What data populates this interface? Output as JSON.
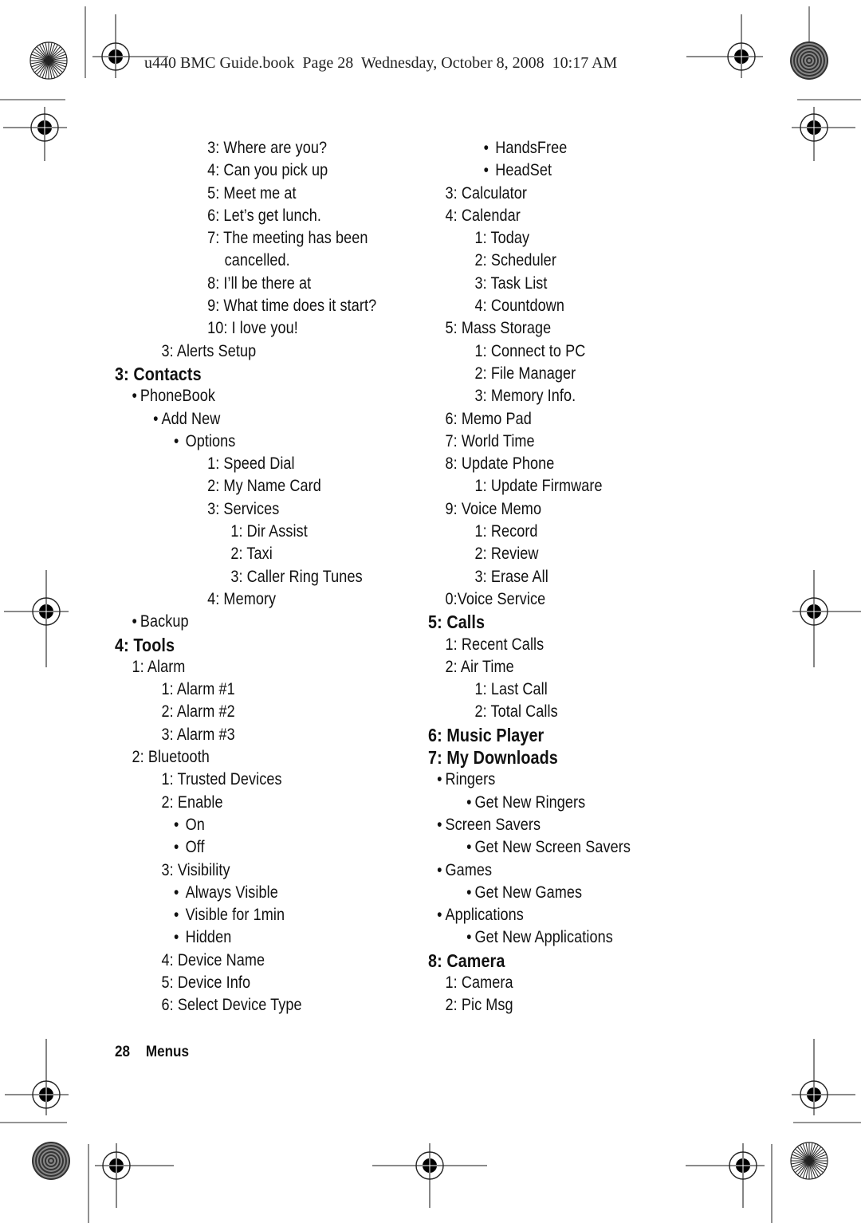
{
  "header": {
    "slug": "u440 BMC Guide.book  Page 28  Wednesday, October 8, 2008  10:17 AM"
  },
  "left_column": [
    {
      "text": "3: Where are you?",
      "level": 4,
      "kind": "item"
    },
    {
      "text": "4: Can you pick up",
      "level": 4,
      "kind": "item"
    },
    {
      "text": "5: Meet me at",
      "level": 4,
      "kind": "item"
    },
    {
      "text": "6: Let’s get lunch.",
      "level": 4,
      "kind": "item"
    },
    {
      "text": "7: The meeting has been",
      "level": 4,
      "kind": "item"
    },
    {
      "text": "cancelled.",
      "level": 4,
      "kind": "continuation"
    },
    {
      "text": "8: I’ll be there at",
      "level": 4,
      "kind": "item"
    },
    {
      "text": "9: What time does it start?",
      "level": 4,
      "kind": "item"
    },
    {
      "text": "10: I love you!",
      "level": 4,
      "kind": "item"
    },
    {
      "text": "3: Alerts Setup",
      "level": 2,
      "kind": "item"
    },
    {
      "text": "3: Contacts",
      "level": 0,
      "kind": "heading"
    },
    {
      "text": "PhoneBook",
      "level": 1,
      "kind": "bullet"
    },
    {
      "text": "Add New",
      "level": 2,
      "kind": "bullet"
    },
    {
      "text": "Options",
      "level": 3,
      "kind": "bullet-wide"
    },
    {
      "text": "1: Speed Dial",
      "level": 4,
      "kind": "item"
    },
    {
      "text": "2: My Name Card",
      "level": 4,
      "kind": "item"
    },
    {
      "text": "3: Services",
      "level": 4,
      "kind": "item"
    },
    {
      "text": "1: Dir Assist",
      "level": 5,
      "kind": "item"
    },
    {
      "text": "2: Taxi",
      "level": 5,
      "kind": "item"
    },
    {
      "text": "3: Caller Ring Tunes",
      "level": 5,
      "kind": "item"
    },
    {
      "text": "4: Memory",
      "level": 4,
      "kind": "item"
    },
    {
      "text": "Backup",
      "level": 1,
      "kind": "bullet"
    },
    {
      "text": "4: Tools",
      "level": 0,
      "kind": "heading"
    },
    {
      "text": "1: Alarm",
      "level": 1,
      "kind": "item"
    },
    {
      "text": "1: Alarm #1",
      "level": 2,
      "kind": "item"
    },
    {
      "text": "2: Alarm #2",
      "level": 2,
      "kind": "item"
    },
    {
      "text": "3: Alarm #3",
      "level": 2,
      "kind": "item"
    },
    {
      "text": "2: Bluetooth",
      "level": 1,
      "kind": "item"
    },
    {
      "text": "1: Trusted Devices",
      "level": 2,
      "kind": "item"
    },
    {
      "text": "2: Enable",
      "level": 2,
      "kind": "item"
    },
    {
      "text": "On",
      "level": 3,
      "kind": "bullet-wide"
    },
    {
      "text": "Off",
      "level": 3,
      "kind": "bullet-wide"
    },
    {
      "text": "3: Visibility",
      "level": 2,
      "kind": "item"
    },
    {
      "text": "Always Visible",
      "level": 3,
      "kind": "bullet-wide"
    },
    {
      "text": "Visible for 1min",
      "level": 3,
      "kind": "bullet-wide"
    },
    {
      "text": "Hidden",
      "level": 3,
      "kind": "bullet-wide"
    },
    {
      "text": "4: Device Name",
      "level": 2,
      "kind": "item"
    },
    {
      "text": "5: Device Info",
      "level": 2,
      "kind": "item"
    },
    {
      "text": "6: Select Device Type",
      "level": 2,
      "kind": "item"
    }
  ],
  "right_column": [
    {
      "text": "HandsFree",
      "level": 3,
      "kind": "bullet-wide"
    },
    {
      "text": "HeadSet",
      "level": 3,
      "kind": "bullet-wide"
    },
    {
      "text": "3: Calculator",
      "level": 1,
      "kind": "item"
    },
    {
      "text": "4: Calendar",
      "level": 1,
      "kind": "item"
    },
    {
      "text": "1: Today",
      "level": 2,
      "kind": "item"
    },
    {
      "text": "2: Scheduler",
      "level": 2,
      "kind": "item"
    },
    {
      "text": "3: Task List",
      "level": 2,
      "kind": "item"
    },
    {
      "text": "4: Countdown",
      "level": 2,
      "kind": "item"
    },
    {
      "text": "5: Mass Storage",
      "level": 1,
      "kind": "item"
    },
    {
      "text": "1: Connect to PC",
      "level": 2,
      "kind": "item"
    },
    {
      "text": "2: File Manager",
      "level": 2,
      "kind": "item"
    },
    {
      "text": "3: Memory Info.",
      "level": 2,
      "kind": "item"
    },
    {
      "text": "6: Memo Pad",
      "level": 1,
      "kind": "item"
    },
    {
      "text": "7: World Time",
      "level": 1,
      "kind": "item"
    },
    {
      "text": "8: Update Phone",
      "level": 1,
      "kind": "item"
    },
    {
      "text": "1: Update Firmware",
      "level": 2,
      "kind": "item"
    },
    {
      "text": "9: Voice Memo",
      "level": 1,
      "kind": "item"
    },
    {
      "text": "1: Record",
      "level": 2,
      "kind": "item"
    },
    {
      "text": "2: Review",
      "level": 2,
      "kind": "item"
    },
    {
      "text": "3: Erase All",
      "level": 2,
      "kind": "item"
    },
    {
      "text": "0:Voice Service",
      "level": 1,
      "kind": "item"
    },
    {
      "text": "5: Calls",
      "level": 0,
      "kind": "heading"
    },
    {
      "text": "1: Recent Calls",
      "level": 1,
      "kind": "item"
    },
    {
      "text": "2: Air Time",
      "level": 1,
      "kind": "item"
    },
    {
      "text": "1: Last Call",
      "level": 2,
      "kind": "item"
    },
    {
      "text": "2: Total Calls",
      "level": 2,
      "kind": "item"
    },
    {
      "text": "6: Music Player",
      "level": 0,
      "kind": "heading"
    },
    {
      "text": "7: My Downloads",
      "level": 0,
      "kind": "heading"
    },
    {
      "text": "Ringers",
      "level": 1,
      "kind": "bullet"
    },
    {
      "text": "Get New Ringers",
      "level": 2,
      "kind": "bullet"
    },
    {
      "text": "Screen Savers",
      "level": 1,
      "kind": "bullet"
    },
    {
      "text": "Get New Screen Savers",
      "level": 2,
      "kind": "bullet"
    },
    {
      "text": "Games",
      "level": 1,
      "kind": "bullet"
    },
    {
      "text": "Get New Games",
      "level": 2,
      "kind": "bullet"
    },
    {
      "text": "Applications",
      "level": 1,
      "kind": "bullet"
    },
    {
      "text": "Get New Applications",
      "level": 2,
      "kind": "bullet"
    },
    {
      "text": "8: Camera",
      "level": 0,
      "kind": "heading"
    },
    {
      "text": "1: Camera",
      "level": 1,
      "kind": "item"
    },
    {
      "text": "2: Pic Msg",
      "level": 1,
      "kind": "item"
    }
  ],
  "footer": {
    "page_number": "28",
    "section": "Menus"
  },
  "print_marks": {
    "registration_mark_icon": "crosshair-target",
    "starburst_icon": "radial-starburst",
    "concentric_icon": "concentric-circles"
  }
}
